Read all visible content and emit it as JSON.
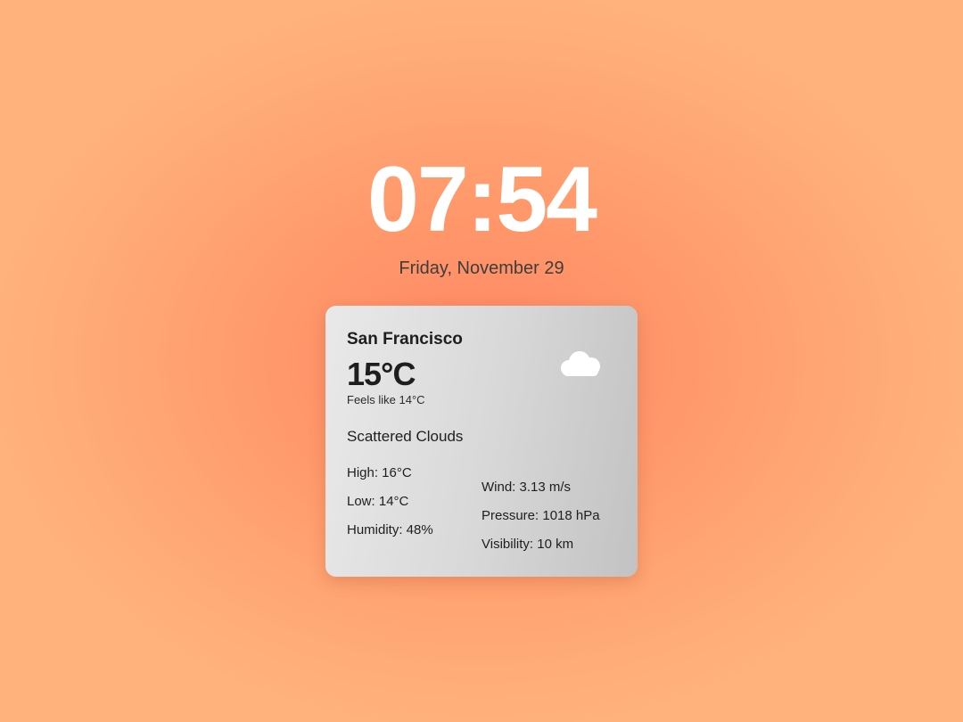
{
  "clock": {
    "time": "07:54",
    "date": "Friday, November 29"
  },
  "weather": {
    "city": "San Francisco",
    "temperature": "15°C",
    "feels_like": "Feels like 14°C",
    "icon": "cloud-icon",
    "description": "Scattered Clouds",
    "left_stats": {
      "high": "High: 16°C",
      "low": "Low: 14°C",
      "humidity": "Humidity: 48%"
    },
    "right_stats": {
      "wind": "Wind: 3.13 m/s",
      "pressure": "Pressure: 1018 hPa",
      "visibility": "Visibility: 10 km"
    }
  },
  "colors": {
    "background_center": "#ff8763",
    "background_edge": "#ffb27c",
    "clock_text": "#ffffff",
    "card_light": "#e9e9e9",
    "card_dark": "#c2c2c2"
  }
}
